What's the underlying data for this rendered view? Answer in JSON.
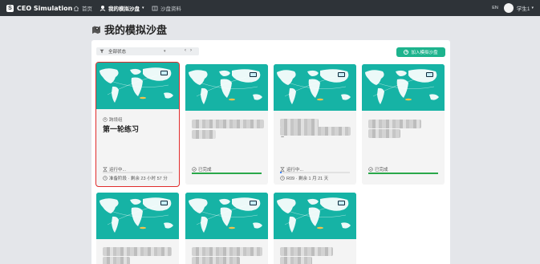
{
  "nav": {
    "brand": "CEO Simulation",
    "brand_icon": "logo-icon",
    "home": "首页",
    "sandbox": "我的模拟沙盘",
    "sandbox_suffix": "▾",
    "library": "沙盘资料",
    "lang": "EN",
    "user": "学生1",
    "user_caret": "▾"
  },
  "page": {
    "title": "我的模拟沙盘"
  },
  "toolbar": {
    "filter_label": "全部状态",
    "filter_caret": "▾",
    "prev": "‹",
    "next": "›",
    "join_button": "加入模拟沙盘",
    "join_icon": "+"
  },
  "cards": [
    {
      "tag": "跨境组",
      "name": "第一轮练习",
      "status": "运行中...",
      "meta": "准备阶段 · 剩余 23 小时 57 分",
      "progress": 0,
      "selected": true
    },
    {
      "name_hidden": true,
      "status": "已完成",
      "progress": 1.0
    },
    {
      "name_hidden": true,
      "tilde": "~",
      "status": "运行中...",
      "meta": "R09 · 剩余 1 月 21 天",
      "progress": 0.02
    },
    {
      "name_hidden": true,
      "status": "已完成",
      "progress": 1.0
    },
    {
      "name_hidden": true
    },
    {
      "name_hidden": true
    },
    {
      "name_hidden": true
    }
  ],
  "colors": {
    "accent": "#1db38d",
    "map_sea": "#16b3a5",
    "map_land": "#ffffff",
    "complete": "#2aa84a",
    "selected_border": "#e02b2b",
    "nav_bg": "#2e3338"
  }
}
